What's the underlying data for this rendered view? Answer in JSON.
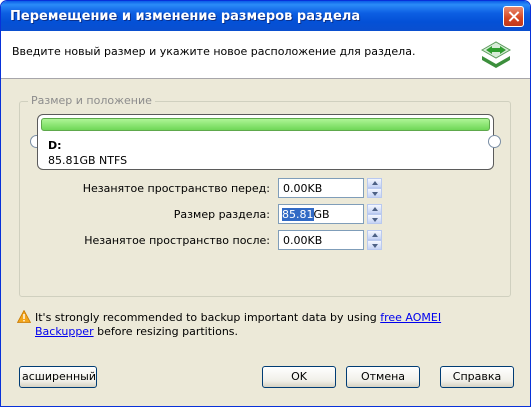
{
  "window": {
    "title": "Перемещение и изменение размеров раздела"
  },
  "header": {
    "instruction": "Введите новый размер и укажите новое расположение для раздела.",
    "icon": "resize-arrows-icon"
  },
  "group": {
    "label": "Размер и положение",
    "partition": {
      "letter": "D:",
      "info": "85.81GB NTFS",
      "bar_color": "#8fe877"
    }
  },
  "fields": {
    "unallocated_before": {
      "label": "Незанятое пространство перед:",
      "value": "0.00KB"
    },
    "partition_size": {
      "label": "Размер раздела:",
      "value_selected": "85.81",
      "value_rest": "GB"
    },
    "unallocated_after": {
      "label": "Незанятое пространство после:",
      "value": "0.00KB"
    }
  },
  "warning": {
    "text_before": "It's strongly recommended to backup important data by using ",
    "link": "free AOMEI Backupper",
    "text_after": " before resizing partitions."
  },
  "buttons": {
    "advanced": "асширенный>>",
    "ok": "OK",
    "cancel": "Отмена",
    "help": "Справка"
  }
}
